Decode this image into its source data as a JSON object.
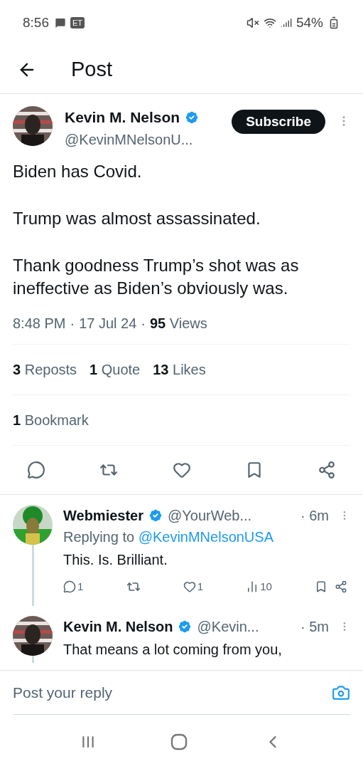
{
  "status_bar": {
    "time": "8:56",
    "badge": "ET",
    "battery": "54%"
  },
  "header": {
    "title": "Post"
  },
  "post": {
    "name": "Kevin M. Nelson",
    "handle": "@KevinMNelsonU...",
    "subscribe": "Subscribe",
    "paragraphs": [
      "Biden has Covid.",
      "Trump was almost assassinated.",
      "Thank goodness Trump’s shot was as ineffective as Biden’s obviously was."
    ],
    "time": "8:48 PM",
    "separator": "·",
    "date": "17 Jul 24",
    "views_count": "95",
    "views_label": "Views",
    "stats": [
      {
        "count": "3",
        "label": "Reposts"
      },
      {
        "count": "1",
        "label": "Quote"
      },
      {
        "count": "13",
        "label": "Likes"
      }
    ],
    "bookmarks": {
      "count": "1",
      "label": "Bookmark"
    }
  },
  "replies": [
    {
      "name": "Webmiester",
      "handle": "@YourWeb...",
      "time": "· 6m",
      "replying_label": "Replying to",
      "replying_handle": "@KevinMNelsonUSA",
      "text": "This. Is. Brilliant.",
      "reply_count": "1",
      "like_count": "1",
      "view_count": "10"
    },
    {
      "name": "Kevin M. Nelson",
      "handle": "@Kevin...",
      "time": "· 5m",
      "text": "That means a lot coming from you,"
    }
  ],
  "reply_box": {
    "placeholder": "Post your reply"
  }
}
